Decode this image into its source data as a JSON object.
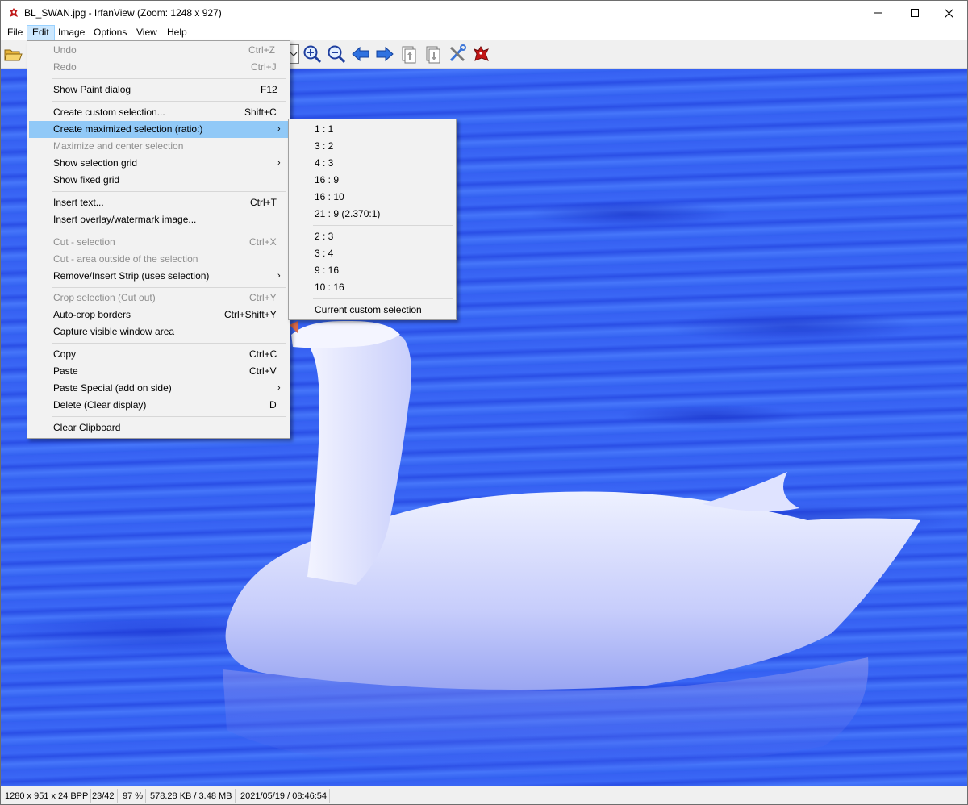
{
  "window": {
    "title": "BL_SWAN.jpg - IrfanView (Zoom: 1248 x 927)"
  },
  "menubar": {
    "items": [
      "File",
      "Edit",
      "Image",
      "Options",
      "View",
      "Help"
    ]
  },
  "edit_menu": {
    "items": [
      {
        "label": "Undo",
        "shortcut": "Ctrl+Z",
        "disabled": true
      },
      {
        "label": "Redo",
        "shortcut": "Ctrl+J",
        "disabled": true
      },
      {
        "label": "Show Paint dialog",
        "shortcut": "F12"
      },
      {
        "label": "Create custom selection...",
        "shortcut": "Shift+C"
      },
      {
        "label": "Create maximized selection (ratio:)",
        "submenu": true,
        "highlighted": true
      },
      {
        "label": "Maximize and center selection",
        "disabled": true
      },
      {
        "label": "Show selection grid",
        "submenu": true
      },
      {
        "label": "Show fixed grid"
      },
      {
        "label": "Insert text...",
        "shortcut": "Ctrl+T"
      },
      {
        "label": "Insert overlay/watermark image..."
      },
      {
        "label": "Cut - selection",
        "shortcut": "Ctrl+X",
        "disabled": true
      },
      {
        "label": "Cut - area outside of the selection",
        "disabled": true
      },
      {
        "label": "Remove/Insert Strip (uses selection)",
        "submenu": true
      },
      {
        "label": "Crop selection (Cut out)",
        "shortcut": "Ctrl+Y",
        "disabled": true
      },
      {
        "label": "Auto-crop borders",
        "shortcut": "Ctrl+Shift+Y"
      },
      {
        "label": "Capture visible window area"
      },
      {
        "label": "Copy",
        "shortcut": "Ctrl+C"
      },
      {
        "label": "Paste",
        "shortcut": "Ctrl+V"
      },
      {
        "label": "Paste Special (add on side)",
        "submenu": true
      },
      {
        "label": "Delete (Clear display)",
        "shortcut": "D"
      },
      {
        "label": "Clear Clipboard"
      }
    ]
  },
  "ratio_submenu": {
    "items": [
      "1 : 1",
      "3 : 2",
      "4 : 3",
      "16 : 9",
      "16 : 10",
      "21 : 9 (2.370:1)",
      "2 : 3",
      "3 : 4",
      "9 : 16",
      "10 : 16",
      "Current custom selection"
    ]
  },
  "statusbar": {
    "dimensions": "1280 x 951 x 24 BPP",
    "index": "23/42",
    "zoom": "97 %",
    "size": "578.28 KB / 3.48 MB",
    "datetime": "2021/05/19 / 08:46:54"
  },
  "toolbar": {
    "icons": [
      "open-folder-icon",
      "zoom-in-icon",
      "zoom-out-icon",
      "previous-icon",
      "next-icon",
      "copy-page-icon",
      "paste-page-icon",
      "settings-tools-icon",
      "irfanview-cat-icon"
    ]
  },
  "colors": {
    "menu_highlight": "#91c9f7",
    "menu_background": "#f2f2f2",
    "disabled_text": "#8d8d8d",
    "water": "#3a67f5"
  }
}
